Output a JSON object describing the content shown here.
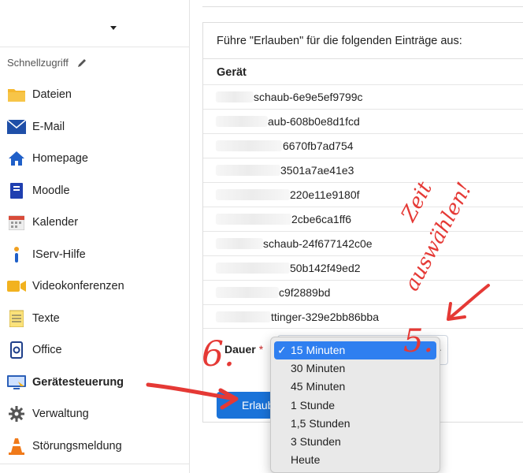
{
  "sidebar": {
    "quick_access_label": "Schnellzugriff",
    "items": [
      {
        "label": "Dateien",
        "icon": "folder-icon"
      },
      {
        "label": "E-Mail",
        "icon": "mail-icon"
      },
      {
        "label": "Homepage",
        "icon": "home-icon"
      },
      {
        "label": "Moodle",
        "icon": "book-icon"
      },
      {
        "label": "Kalender",
        "icon": "calendar-icon"
      },
      {
        "label": "IServ-Hilfe",
        "icon": "help-icon"
      },
      {
        "label": "Videokonferenzen",
        "icon": "video-icon"
      },
      {
        "label": "Texte",
        "icon": "notepad-icon"
      },
      {
        "label": "Office",
        "icon": "office-icon"
      },
      {
        "label": "Gerätesteuerung",
        "icon": "monitor-icon"
      },
      {
        "label": "Verwaltung",
        "icon": "gear-icon"
      },
      {
        "label": "Störungsmeldung",
        "icon": "traffic-cone-icon"
      }
    ]
  },
  "main": {
    "heading": "Führe \"Erlauben\" für die folgenden Einträge aus:",
    "column_header": "Gerät",
    "devices": [
      "schaub-6e9e5ef9799c",
      "aub-608b0e8d1fcd",
      "6670fb7ad754",
      "3501a7ae41e3",
      "220e11e9180f",
      "2cbe6ca1ff6",
      "schaub-24f677142c0e",
      "50b142f49ed2",
      "c9f2889bd",
      "ttinger-329e2bb86bba"
    ],
    "duration_label": "Dauer",
    "required_mark": "*",
    "submit_label": "Erlaub"
  },
  "dropdown": {
    "selected": "15 Minuten",
    "options": [
      "15 Minuten",
      "30 Minuten",
      "45 Minuten",
      "1 Stunde",
      "1,5 Stunden",
      "3 Stunden",
      "Heute"
    ]
  },
  "annotations": {
    "step5": "5.",
    "step6": "6.",
    "note_line1": "Zeit",
    "note_line2": "auswählen!"
  },
  "colors": {
    "accent": "#1a73d9",
    "selected_option": "#2f7ff0",
    "annotation": "#e53935",
    "required": "#c62828"
  }
}
